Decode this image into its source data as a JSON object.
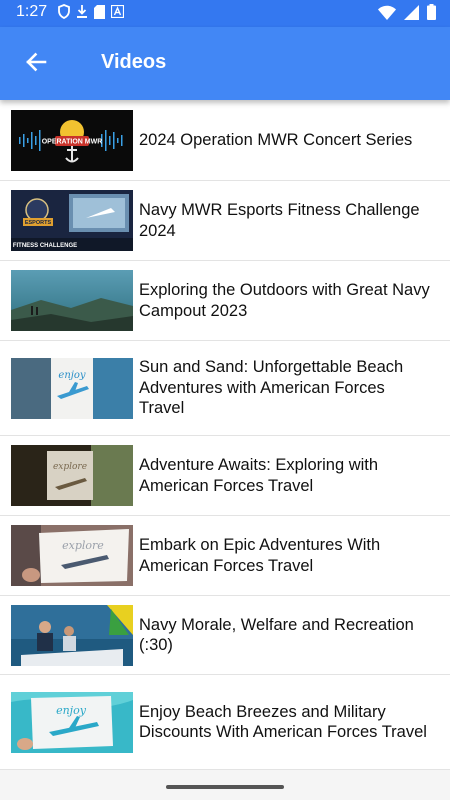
{
  "status_bar": {
    "time": "1:27",
    "icons": [
      "shield-icon",
      "download-icon",
      "sd-card-icon",
      "font-a-icon",
      "wifi-icon",
      "signal-icon",
      "battery-icon"
    ]
  },
  "app_bar": {
    "title": "Videos",
    "back_icon": "arrow-back-icon"
  },
  "colors": {
    "app_bar": "#4287f5",
    "status_bar": "#3478f0",
    "divider": "#e3e3e3"
  },
  "videos": [
    {
      "title": "2024 Operation MWR Concert Series",
      "thumb_text": [
        "OPERATION MWR"
      ]
    },
    {
      "title": "Navy MWR Esports Fitness Challenge 2024",
      "thumb_text": [
        "ESPORTS",
        "FITNESS CHALLENGE"
      ]
    },
    {
      "title": "Exploring the Outdoors with Great Navy Campout 2023",
      "thumb_text": []
    },
    {
      "title": "Sun and Sand: Unforgettable Beach Adventures with American Forces Travel",
      "thumb_text": [
        "enjoy"
      ]
    },
    {
      "title": "Adventure Awaits: Exploring with American Forces Travel",
      "thumb_text": [
        "explore"
      ]
    },
    {
      "title": "Embark on Epic Adventures With American Forces Travel",
      "thumb_text": [
        "explore"
      ]
    },
    {
      "title": "Navy Morale, Welfare and Recreation (:30)",
      "thumb_text": []
    },
    {
      "title": "Enjoy Beach Breezes and Military Discounts With American Forces Travel",
      "thumb_text": [
        "enjoy"
      ]
    }
  ]
}
